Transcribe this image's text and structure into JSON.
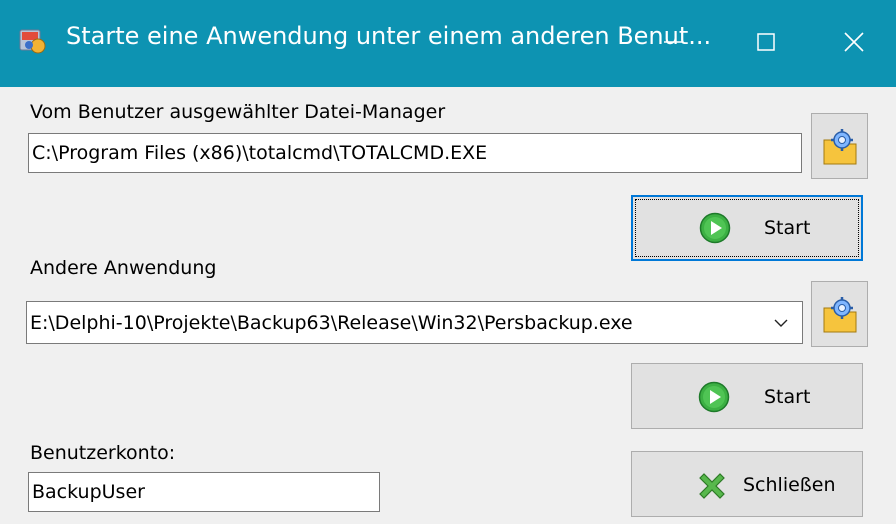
{
  "window": {
    "title": "Starte eine Anwendung unter einem anderen Benut...",
    "colors": {
      "titlebar": "#0d93b2",
      "background": "#f0f0f0",
      "focus": "#0078d7"
    }
  },
  "file_manager": {
    "label": "Vom Benutzer ausgewählter Datei-Manager",
    "value": "C:\\Program Files (x86)\\totalcmd\\TOTALCMD.EXE",
    "browse_icon": "folder-gear-icon",
    "start_label": "Start"
  },
  "other_app": {
    "label": "Andere Anwendung",
    "value": "E:\\Delphi-10\\Projekte\\Backup63\\Release\\Win32\\Persbackup.exe",
    "browse_icon": "folder-gear-icon",
    "start_label": "Start"
  },
  "account": {
    "label": "Benutzerkonto:",
    "value": "BackupUser"
  },
  "close_button": {
    "label": "Schließen",
    "icon": "red-x-icon"
  }
}
